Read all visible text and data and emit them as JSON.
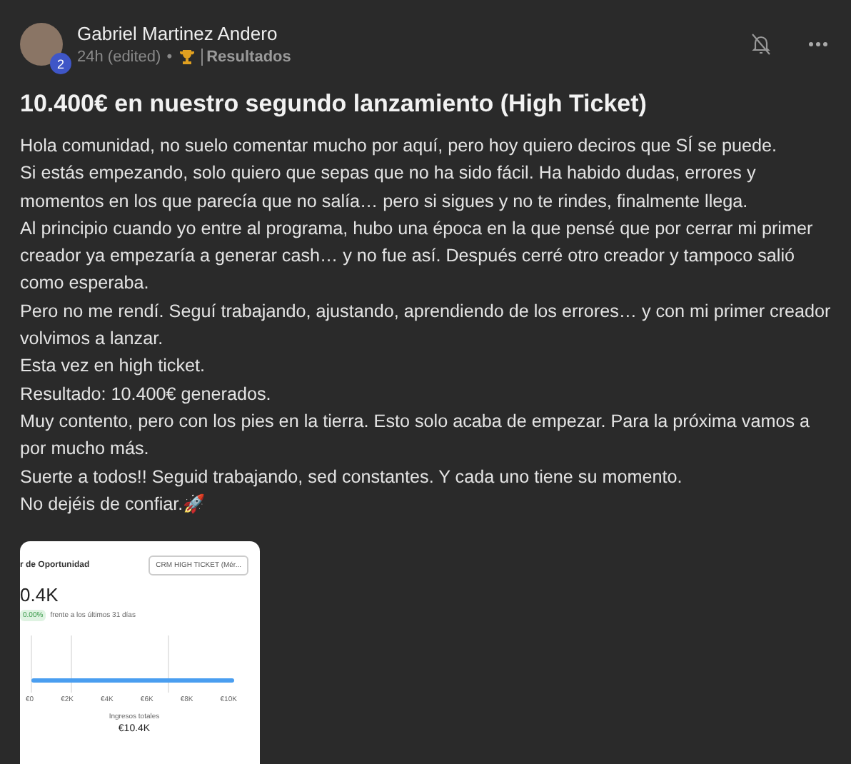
{
  "post": {
    "author": "Gabriel Martinez Andero",
    "level_badge": "2",
    "time": "24h (edited)",
    "separator": "•",
    "category": "Resultados",
    "title": "10.400€ en nuestro segundo lanzamiento (High Ticket)",
    "paragraphs": [
      "Hola comunidad, no suelo comentar mucho por aquí, pero hoy quiero deciros que SÍ se puede.",
      "Si estás empezando, solo quiero que sepas que no ha sido fácil. Ha habido dudas, errores y momentos en los que parecía que no salía… pero si sigues y no te rindes, finalmente llega.",
      "Al principio cuando yo entre al programa, hubo una época en la que pensé que por cerrar mi primer creador ya empezaría a generar cash… y no fue así. Después cerré otro creador y tampoco salió como esperaba.",
      "Pero no me rendí. Seguí trabajando, ajustando, aprendiendo de los errores… y con mi primer creador volvimos a lanzar.",
      "Esta vez en high ticket.",
      "Resultado: 10.400€ generados.",
      "Muy contento, pero con los pies en la tierra. Esto solo acaba de empezar. Para la próxima vamos a por mucho más.",
      "Suerte a todos!! Seguid trabajando, sed constantes. Y cada uno tiene su momento.",
      "No dejéis de confiar.🚀"
    ],
    "attachment": {
      "heading": "r de Oportunidad",
      "select": "CRM HIGH TICKET (Mér...",
      "value": "0.4K",
      "change": "0.00%",
      "comparison": "frente a los últimos 31 días",
      "ticks": [
        "€0",
        "€2K",
        "€4K",
        "€6K",
        "€8K",
        "€10K"
      ],
      "total_label": "Ingresos totales",
      "total": "€10.4K"
    }
  }
}
